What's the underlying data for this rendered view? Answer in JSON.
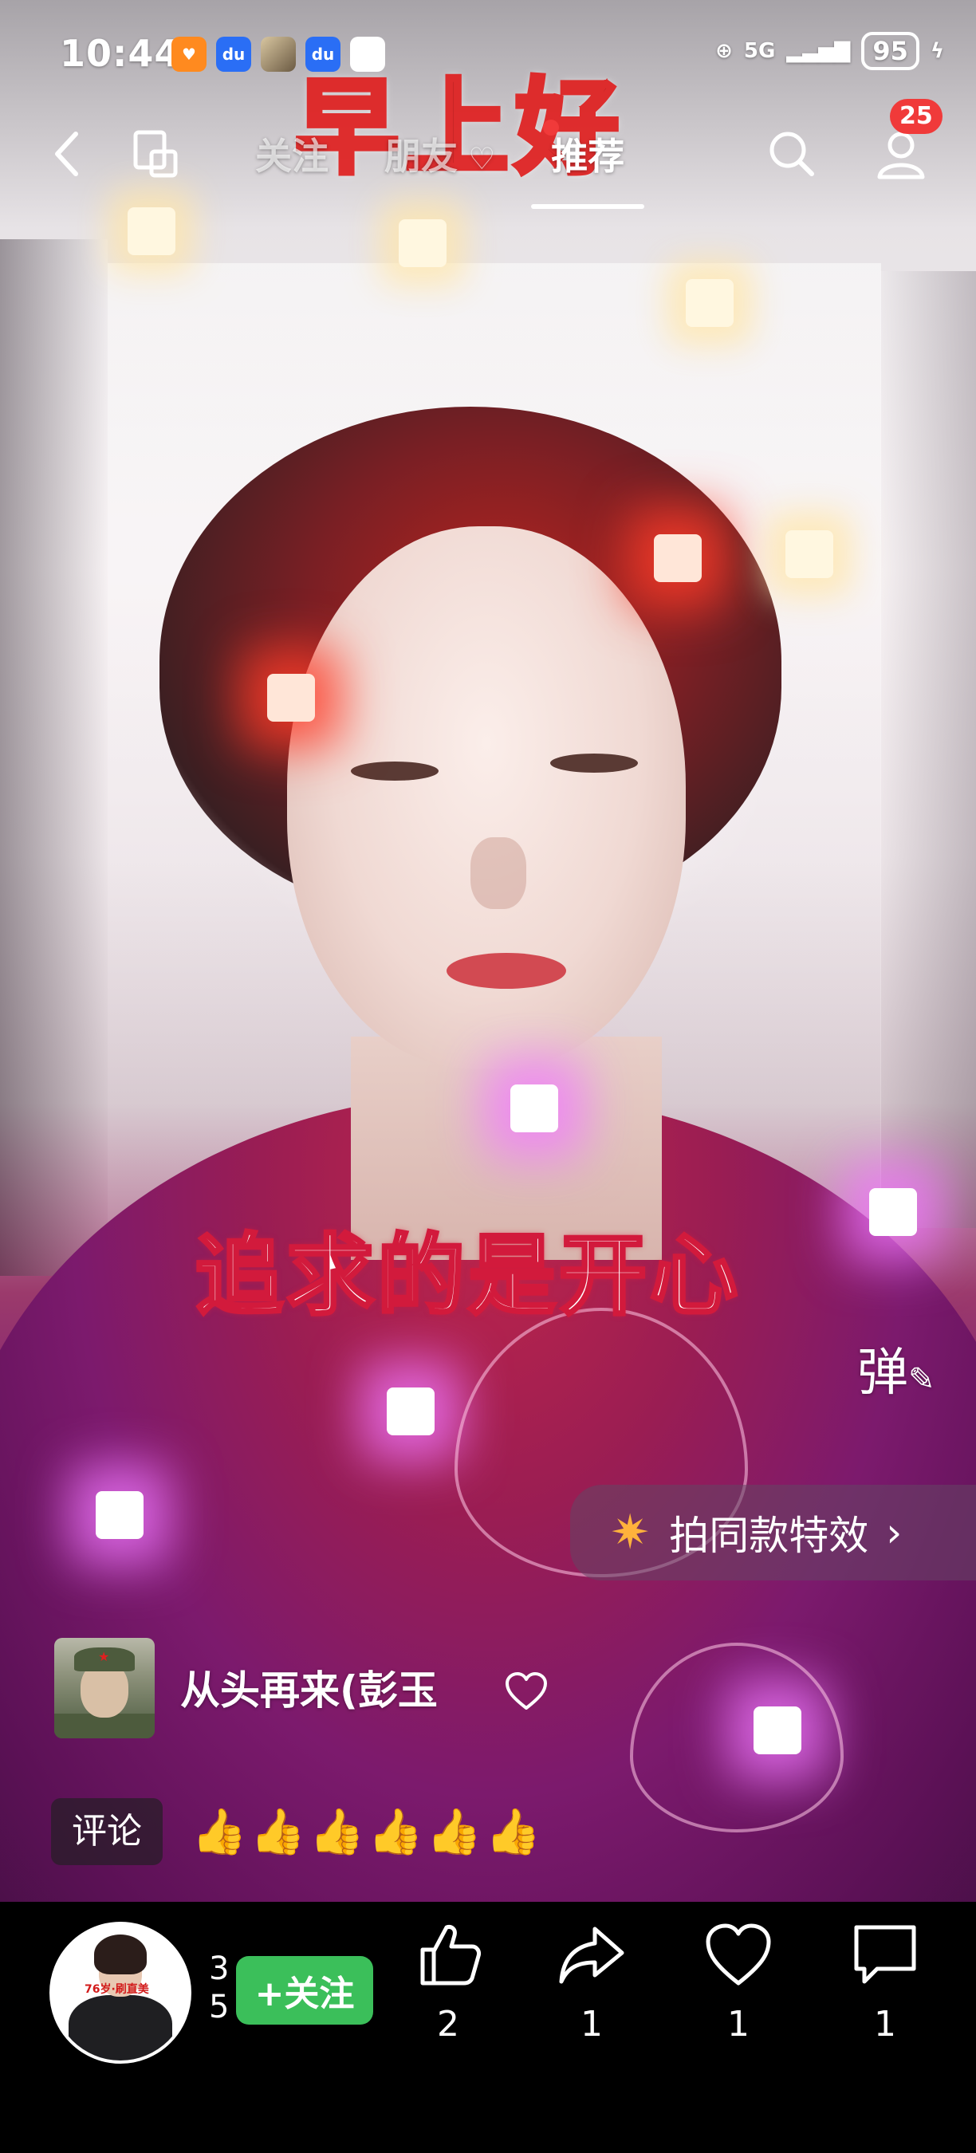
{
  "status_bar": {
    "time": "10:44",
    "network": "5G",
    "battery": "95"
  },
  "nav": {
    "tabs": [
      {
        "label": "关注"
      },
      {
        "label": "朋友"
      },
      {
        "label": "推荐"
      }
    ],
    "active_tab": "推荐",
    "notification_badge": "25"
  },
  "video": {
    "caption_top": "早上好",
    "caption_main": "追求的是开心",
    "danmu_label": "弹"
  },
  "effect": {
    "label": "拍同款特效",
    "arrow": "›"
  },
  "commenter": {
    "name": "从头再来(彭玉"
  },
  "comment": {
    "tag_label": "评论",
    "emoji_text": "👍👍👍👍👍👍"
  },
  "bottom_bar": {
    "follow_label": "+关注",
    "author_name": "3\n5",
    "avatar_text": "76岁·刷直美",
    "actions": [
      {
        "name": "like",
        "count": "2"
      },
      {
        "name": "share",
        "count": "1"
      },
      {
        "name": "favorite",
        "count": "1"
      },
      {
        "name": "comment",
        "count": "1"
      }
    ]
  },
  "colors": {
    "follow_green": "#3bbf5a",
    "badge_red": "#f03a3a",
    "effect_star": "#ffb23c"
  }
}
